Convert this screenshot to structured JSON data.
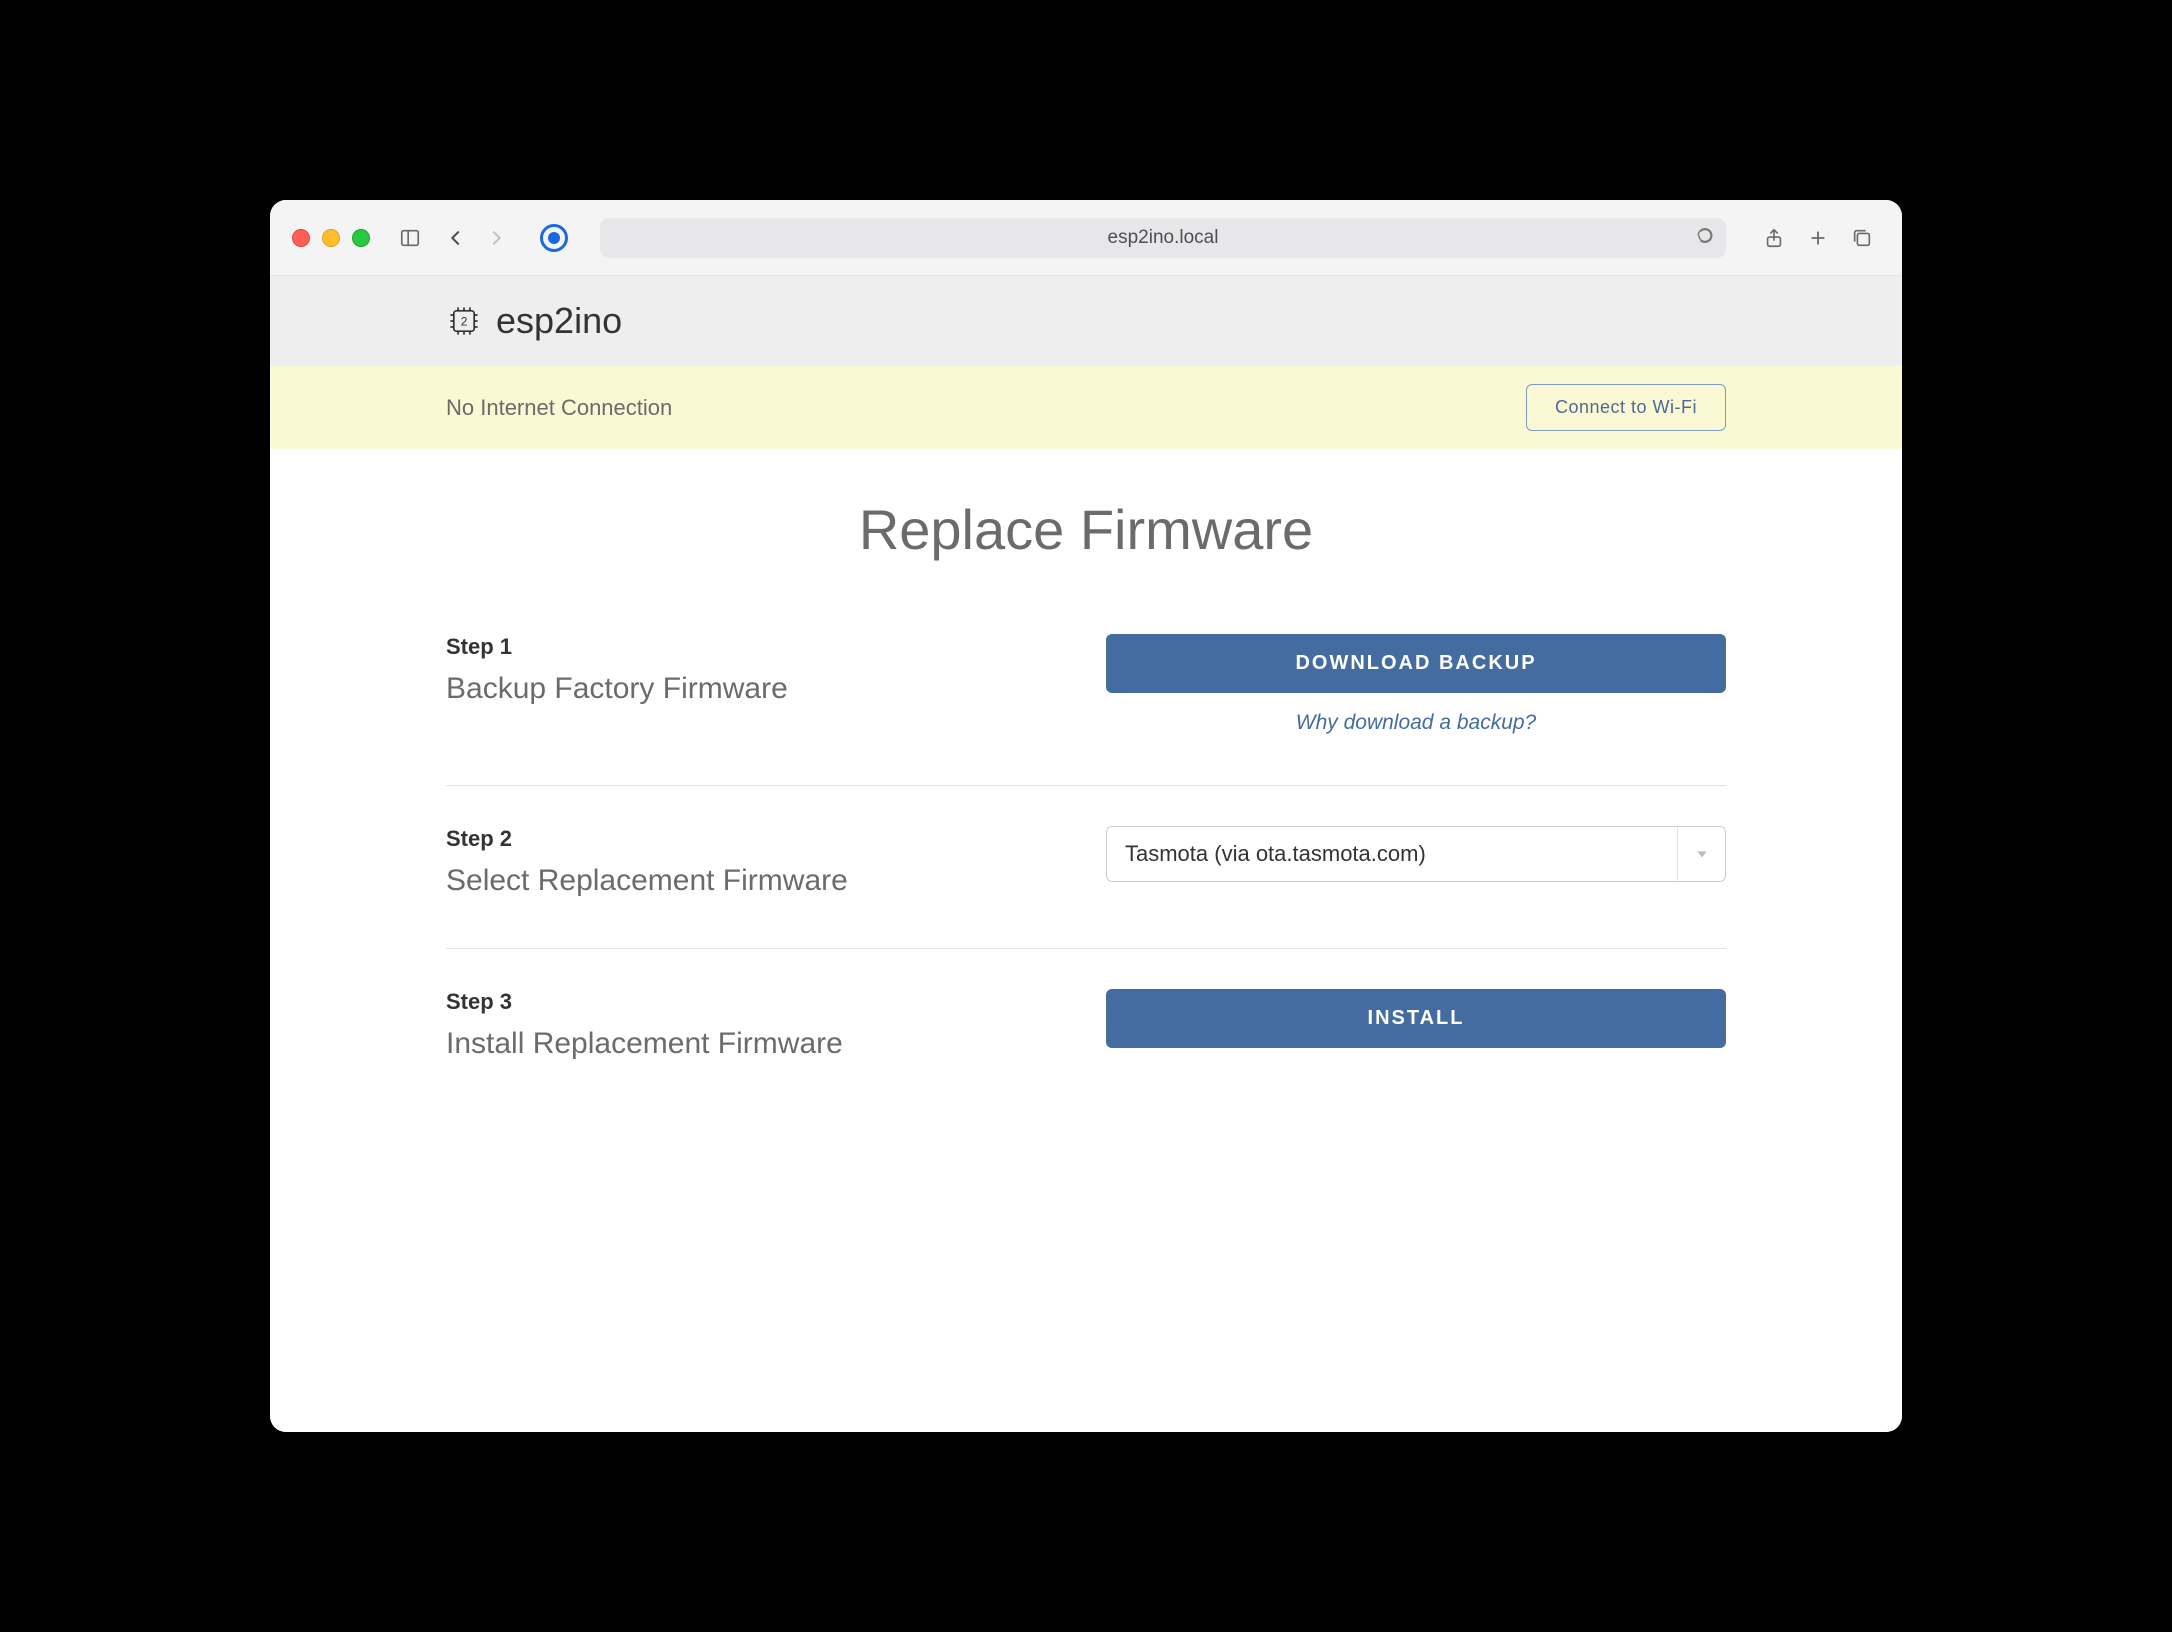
{
  "browser": {
    "url": "esp2ino.local"
  },
  "brand": {
    "name": "esp2ino",
    "chip_label": "2"
  },
  "notice": {
    "message": "No Internet Connection",
    "wifi_button": "Connect to Wi-Fi"
  },
  "page": {
    "title": "Replace Firmware"
  },
  "steps": [
    {
      "num": "Step 1",
      "title": "Backup Factory Firmware",
      "button": "DOWNLOAD BACKUP",
      "help": "Why download a backup?"
    },
    {
      "num": "Step 2",
      "title": "Select Replacement Firmware",
      "select_value": "Tasmota (via ota.tasmota.com)"
    },
    {
      "num": "Step 3",
      "title": "Install Replacement Firmware",
      "button": "INSTALL"
    }
  ]
}
